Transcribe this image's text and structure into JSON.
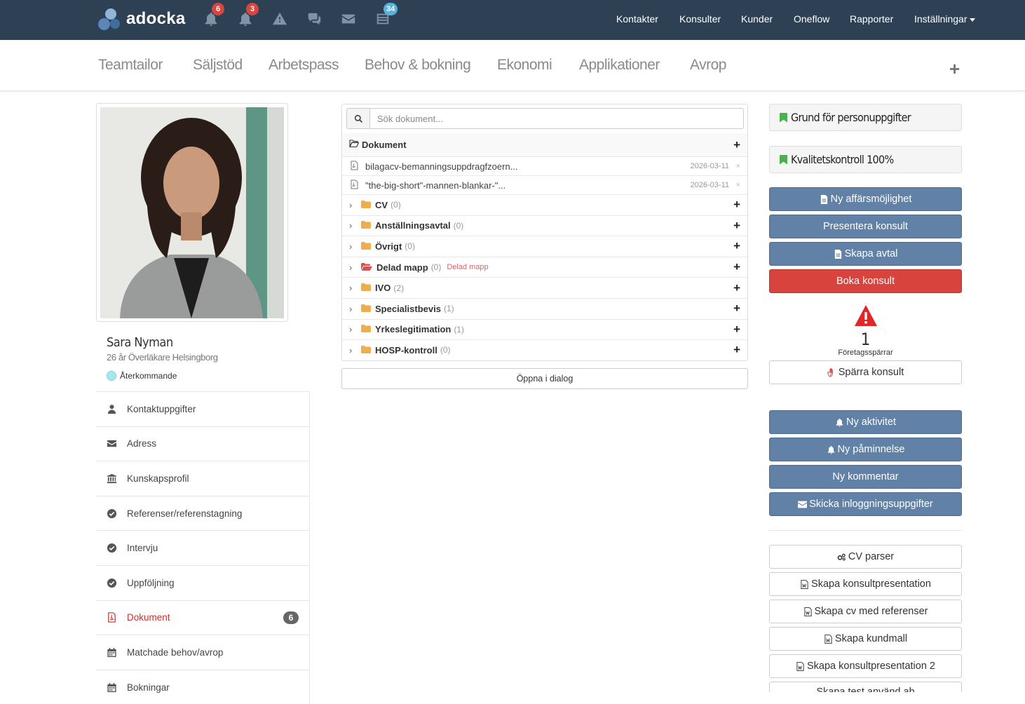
{
  "brand": {
    "name": "adocka"
  },
  "topbar": {
    "badges": {
      "notifications1": "6",
      "notifications2": "3",
      "tasks": "34"
    },
    "nav": [
      "Kontakter",
      "Konsulter",
      "Kunder",
      "Oneflow",
      "Rapporter",
      "Inställningar"
    ]
  },
  "subnav": [
    "Teamtailor",
    "Säljstöd",
    "Arbetspass",
    "Behov & bokning",
    "Ekonomi",
    "Applikationer",
    "Avrop"
  ],
  "profile": {
    "name": "Sara Nyman",
    "subtitle": "26 år Överläkare Helsingborg",
    "status": "Återkommande"
  },
  "sidebar": {
    "items": [
      {
        "label": "Kontaktuppgifter",
        "icon": "user-icon"
      },
      {
        "label": "Adress",
        "icon": "envelope-icon"
      },
      {
        "label": "Kunskapsprofil",
        "icon": "institution-icon"
      },
      {
        "label": "Referenser/referenstagning",
        "icon": "check-circle-icon"
      },
      {
        "label": "Intervju",
        "icon": "check-circle-icon"
      },
      {
        "label": "Uppföljning",
        "icon": "check-circle-icon"
      },
      {
        "label": "Dokument",
        "icon": "file-pdf-icon",
        "badge": "6"
      },
      {
        "label": "Matchade behov/avrop",
        "icon": "calendar-icon"
      },
      {
        "label": "Bokningar",
        "icon": "calendar-icon"
      }
    ]
  },
  "documents": {
    "search_placeholder": "Sök dokument...",
    "root_label": "Dokument",
    "files": [
      {
        "name": "bilagacv-bemanningsuppdragfzoern...",
        "date": "2026-03-11"
      },
      {
        "name": "\"the-big-short\"-mannen-blankar-\"...",
        "date": "2026-03-11"
      }
    ],
    "folders": [
      {
        "name": "CV",
        "count": "(0)"
      },
      {
        "name": "Anställningsavtal",
        "count": "(0)"
      },
      {
        "name": "Övrigt",
        "count": "(0)"
      },
      {
        "name": "Delad mapp",
        "count": "(0)",
        "tag": "Delad mapp"
      },
      {
        "name": "IVO",
        "count": "(2)"
      },
      {
        "name": "Specialistbevis",
        "count": "(1)"
      },
      {
        "name": "Yrkeslegitimation",
        "count": "(1)"
      },
      {
        "name": "HOSP-kontroll",
        "count": "(0)"
      }
    ],
    "open_dialog": "Öppna i dialog"
  },
  "right": {
    "flags": [
      "Grund för personuppgifter",
      "Kvalitetskontroll 100%"
    ],
    "actions1": [
      "Ny affärsmöjlighet",
      "Presentera konsult",
      "Skapa avtal",
      "Boka konsult"
    ],
    "warning": {
      "count": "1",
      "label": "Företagsspärrar"
    },
    "block_button": "Spärra konsult",
    "actions2": [
      "Ny aktivitet",
      "Ny påminnelse",
      "Ny kommentar",
      "Skicka inloggningsuppgifter"
    ],
    "tools": [
      "CV parser",
      "Skapa konsultpresentation",
      "Skapa cv med referenser",
      "Skapa kundmall",
      "Skapa konsultpresentation 2",
      "Skapa test använd ab"
    ]
  },
  "colors": {
    "topbar": "#2e4053",
    "primary_button": "#6281a6",
    "danger_button": "#d9433e",
    "active_link": "#c9302c",
    "flag": "#4caf50"
  }
}
